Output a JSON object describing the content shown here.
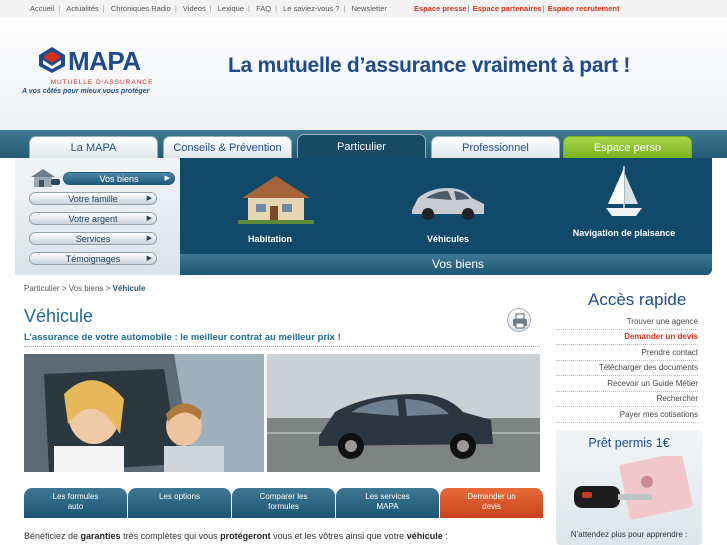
{
  "topnav": {
    "left": [
      "Accueil",
      "Actualités",
      "Chroniques Radio",
      "Videos",
      "Lexique",
      "FAQ",
      "Le saviez-vous ?",
      "Newsletter"
    ],
    "right": [
      "Espace presse",
      "Espace partenaires",
      "Espace recrutement"
    ]
  },
  "header": {
    "brand": "MAPA",
    "brand_sub": "MUTUELLE D'ASSURANCE",
    "tagline": "A vos côtés pour mieux vous protéger",
    "slogan": "La mutuelle d’assurance vraiment à part !"
  },
  "tabs": [
    "La MAPA",
    "Conseils & Prévention",
    "Particulier",
    "Professionnel",
    "Espace perso"
  ],
  "left_menu": [
    "Vos biens",
    "Votre famille",
    "Votre argent",
    "Services",
    "Témoignages"
  ],
  "categories": [
    "Habitation",
    "Véhicules",
    "Navigation de plaisance"
  ],
  "section_bar": "Vos biens",
  "breadcrumb": {
    "a": "Particulier",
    "b": "Vos biens",
    "current": "Véhicule",
    "sep": ">"
  },
  "page": {
    "title": "Véhicule",
    "subtitle": "L’assurance de votre automobile : le meilleur contrat au meilleur prix !"
  },
  "bottom_tabs": [
    "Les formules auto",
    "Les options",
    "Comparer les formules",
    "Les services MAPA",
    "Demander un devis"
  ],
  "intro": {
    "p1": "Bénéficiez de ",
    "b1": "garanties",
    "p2": " très complètes qui vous ",
    "b2": "protégeront",
    "p3": " vous et les vôtres ainsi que votre ",
    "b3": "véhicule",
    "p4": " :"
  },
  "acces": {
    "title": "Accès rapide",
    "links": [
      "Trouver une agence",
      "Demander un devis",
      "Prendre contact",
      "Télécharger des documents",
      "Recevoir un Guide Métier",
      "Rechercher",
      "Payer mes cotisations"
    ]
  },
  "promo": {
    "title": "Prêt permis 1€",
    "text": "N’attendez plus pour apprendre :"
  },
  "colors": {
    "brand": "#1f4a8c",
    "accent": "#d6301a",
    "panel": "#0f4463",
    "green": "#7bb21e"
  }
}
